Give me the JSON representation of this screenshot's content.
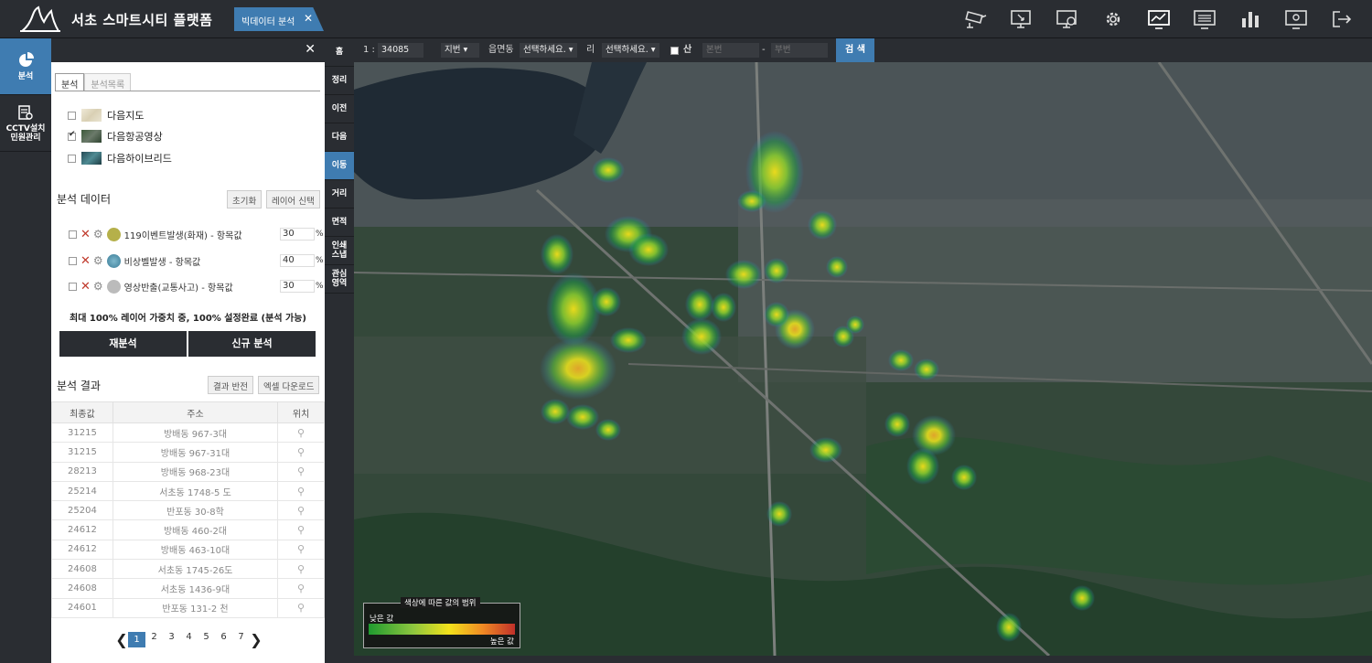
{
  "app": {
    "title": "서초 스마트시티 플랫폼",
    "tab": "빅데이터 분석",
    "tab_close": "✕"
  },
  "toolbar": {
    "icons": [
      "cctv-icon",
      "monitor-settings-icon",
      "monitor-gear-icon",
      "gear-icon",
      "monitor-chart-icon",
      "monitor-list-icon",
      "bar-chart-icon",
      "monitor-config-icon",
      "logout-icon"
    ]
  },
  "leftnav": {
    "items": [
      {
        "label": "분석",
        "icon": "analysis-icon"
      },
      {
        "label": "CCTV설치\n민원관리",
        "icon": "document-icon"
      }
    ]
  },
  "panel": {
    "close": "✕",
    "tabs": [
      "분석",
      "분석목록"
    ],
    "basemaps": [
      {
        "label": "다음지도",
        "checked": false
      },
      {
        "label": "다음항공영상",
        "checked": true
      },
      {
        "label": "다음하이브리드",
        "checked": false
      }
    ],
    "data_title": "분석 데이터",
    "reset_label": "초기화",
    "layer_label": "레이어 신택",
    "layers": [
      {
        "name": "119이벤트발생(화재) - 항목값",
        "pct": "30",
        "color": "#b5b04a"
      },
      {
        "name": "비상벨발생 - 항목값",
        "pct": "40",
        "color": "#4a8fa8"
      },
      {
        "name": "영상반출(교통사고) - 항목값",
        "pct": "30",
        "color": "#bbbbbb"
      }
    ],
    "pct_sign": "%",
    "summary": "최대 100% 레이어 가중치 중, 100% 설정완료 (분석 가능)",
    "reanalyze": "재분석",
    "new_analysis": "신규 분석",
    "result_title": "분석 결과",
    "invert_label": "결과 반전",
    "excel_label": "엑셀 다운로드",
    "columns": [
      "최종값",
      "주소",
      "위치"
    ],
    "rows": [
      {
        "value": "31215",
        "address": "방배동 967-3대"
      },
      {
        "value": "31215",
        "address": "방배동 967-31대"
      },
      {
        "value": "28213",
        "address": "방배동 968-23대"
      },
      {
        "value": "25214",
        "address": "서초동 1748-5 도"
      },
      {
        "value": "25204",
        "address": "반포동 30-8학"
      },
      {
        "value": "24612",
        "address": "방배동 460-2대"
      },
      {
        "value": "24612",
        "address": "방배동 463-10대"
      },
      {
        "value": "24608",
        "address": "서초동 1745-26도"
      },
      {
        "value": "24608",
        "address": "서초동 1436-9대"
      },
      {
        "value": "24601",
        "address": "반포동 131-2 천"
      }
    ],
    "pages": [
      "1",
      "2",
      "3",
      "4",
      "5",
      "6",
      "7"
    ],
    "current_page": "1"
  },
  "vtools": [
    "홈",
    "정리",
    "이전",
    "다음",
    "이동",
    "거리",
    "면적",
    "인쇄\n스냅",
    "관심\n영역"
  ],
  "mapbar": {
    "scale_prefix": "1 :",
    "scale": "34085",
    "jibun": "지번",
    "eup_label": "읍면동",
    "eup_value": "선택하세요.",
    "ri_label": "리",
    "ri_value": "선택하세요.",
    "san": "산",
    "main_no": "본번",
    "dash": "-",
    "sub_no": "부번",
    "search": "검 색"
  },
  "legend": {
    "title": "색상에 따른 값의 범위",
    "low": "낮은 값",
    "high": "높은 값"
  },
  "colors": {
    "accent": "#3f7cb1",
    "dark": "#2a2d32"
  }
}
